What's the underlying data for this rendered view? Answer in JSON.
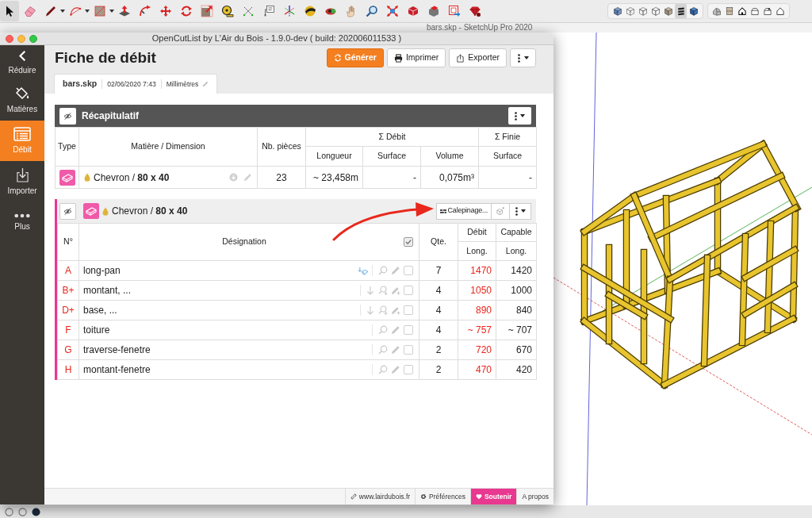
{
  "toolbar": {
    "tools": [
      {
        "kind": "select",
        "selected": true
      },
      {
        "kind": "eraser",
        "selected": false
      },
      {
        "kind": "pencil",
        "selected": false
      },
      {
        "kind": "arc",
        "selected": false
      },
      {
        "kind": "rectangle",
        "selected": false
      },
      {
        "kind": "pushpull",
        "selected": false
      },
      {
        "kind": "followme",
        "selected": false
      },
      {
        "kind": "move",
        "selected": false
      },
      {
        "kind": "rotate",
        "selected": false
      },
      {
        "kind": "scale",
        "selected": false
      },
      {
        "kind": "tape",
        "selected": false
      },
      {
        "kind": "protractor",
        "selected": false
      },
      {
        "kind": "text",
        "selected": false
      },
      {
        "kind": "axes",
        "selected": false
      },
      {
        "kind": "orbit",
        "selected": false
      },
      {
        "kind": "lookaround",
        "selected": false
      },
      {
        "kind": "pan",
        "selected": false
      },
      {
        "kind": "zoom",
        "selected": false
      },
      {
        "kind": "extents",
        "selected": false
      },
      {
        "kind": "warehouse",
        "selected": false
      },
      {
        "kind": "extensions",
        "selected": false
      },
      {
        "kind": "layout",
        "selected": false
      },
      {
        "kind": "ruby",
        "selected": false
      }
    ],
    "styles": [
      {
        "kind": "xray",
        "selected": false
      },
      {
        "kind": "backedges",
        "selected": false
      },
      {
        "kind": "wireframe",
        "selected": false
      },
      {
        "kind": "hiddenline",
        "selected": false
      },
      {
        "kind": "shaded",
        "selected": false
      },
      {
        "kind": "textured",
        "selected": true
      },
      {
        "kind": "monochrome",
        "selected": false
      }
    ],
    "views": [
      {
        "kind": "iso"
      },
      {
        "kind": "top"
      },
      {
        "kind": "front"
      },
      {
        "kind": "right"
      },
      {
        "kind": "back"
      },
      {
        "kind": "left"
      }
    ]
  },
  "sketchup_window": {
    "title": "bars.skp - SketchUp Pro 2020"
  },
  "plugin_window": {
    "title": "OpenCutList by L'Air du Bois - 1.9.0-dev ( build: 202006011533 )"
  },
  "sidebar": {
    "items": [
      {
        "kind": "collapse",
        "label": "Réduire",
        "selected": false
      },
      {
        "kind": "materials",
        "label": "Matières",
        "selected": false
      },
      {
        "kind": "cutlist",
        "label": "Débit",
        "selected": true
      },
      {
        "kind": "import",
        "label": "Importer",
        "selected": false
      },
      {
        "kind": "more",
        "label": "Plus",
        "selected": false
      }
    ]
  },
  "header": {
    "title": "Fiche de débit",
    "buttons": [
      {
        "kind": "generate",
        "label": "Générer",
        "primary": true
      },
      {
        "kind": "print",
        "label": "Imprimer",
        "primary": false
      },
      {
        "kind": "export",
        "label": "Exporter",
        "primary": false
      },
      {
        "kind": "menu",
        "primary": false
      }
    ]
  },
  "file_tab": {
    "filename": "bars.skp",
    "date": "02/06/2020 7:43",
    "unit": "Millimètres"
  },
  "summary": {
    "title": "Récapitulatif",
    "columns": [
      "Type",
      "Matière / Dimension",
      "Nb. pièces"
    ],
    "column_groups": [
      {
        "label": "Σ Débit",
        "columns": [
          "Longueur",
          "Surface",
          "Volume"
        ]
      },
      {
        "label": "Σ Finie",
        "columns": [
          "Surface"
        ]
      }
    ],
    "rows": [
      {
        "material": "Chevron / **80 x 40**",
        "pieces": "23",
        "length": "~ 23,458m",
        "surface": "-",
        "volume": "0,075m³",
        "final_surface": "-"
      }
    ]
  },
  "group": {
    "material": "Chevron / **80 x 40**",
    "buttons": [
      {
        "kind": "layout",
        "label": "Calepinage..."
      },
      {
        "kind": "help"
      },
      {
        "kind": "menu"
      }
    ],
    "columns": [
      "N°",
      "Désignation",
      "Qte."
    ],
    "column_groups": [
      {
        "label": "Débit",
        "columns": [
          "Long."
        ]
      },
      {
        "label": "Capable",
        "columns": [
          "Long."
        ]
      }
    ],
    "all_checked": true,
    "rows": [
      {
        "number": "A",
        "name": "long-pan",
        "kind": "oriented",
        "qty": "7",
        "cut_length": "1470",
        "length": "1420",
        "checked": false
      },
      {
        "number": "B+",
        "name": "montant, ...",
        "kind": "folded",
        "qty": "4",
        "cut_length": "1050",
        "length": "1000",
        "checked": false
      },
      {
        "number": "D+",
        "name": "base, ...",
        "kind": "folded",
        "qty": "4",
        "cut_length": "890",
        "length": "840",
        "checked": false
      },
      {
        "number": "F",
        "name": "toiture",
        "kind": "plain",
        "qty": "4",
        "cut_length": "~ 757",
        "length": "~ 707",
        "checked": false
      },
      {
        "number": "G",
        "name": "traverse-fenetre",
        "kind": "plain",
        "qty": "2",
        "cut_length": "720",
        "length": "670",
        "checked": false
      },
      {
        "number": "H",
        "name": "montant-fenetre",
        "kind": "plain",
        "qty": "2",
        "cut_length": "470",
        "length": "420",
        "checked": false
      }
    ]
  },
  "footer": {
    "links": [
      {
        "kind": "website",
        "label": "www.lairdubois.fr",
        "highlighted": false
      },
      {
        "kind": "preferences",
        "label": "Préférences",
        "highlighted": false
      },
      {
        "kind": "support",
        "label": "Soutenir",
        "highlighted": true
      },
      {
        "kind": "about",
        "label": "A propos",
        "highlighted": false
      }
    ]
  }
}
